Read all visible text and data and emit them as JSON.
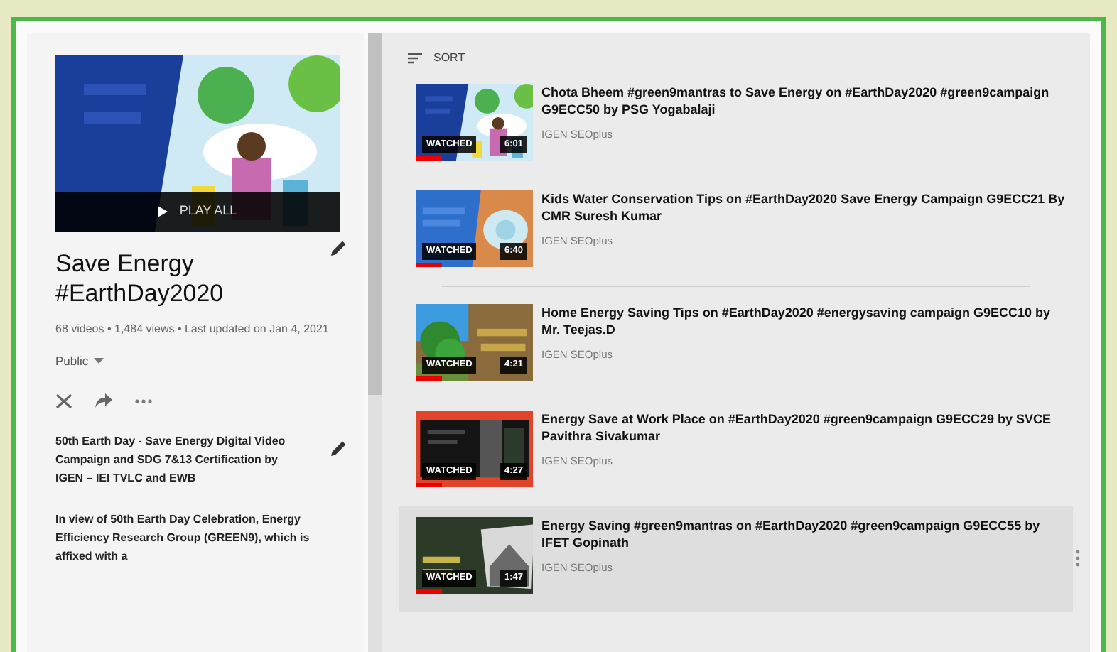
{
  "playlist": {
    "play_all": "PLAY ALL",
    "title": "Save Energy #EarthDay2020",
    "stats": "68 videos • 1,484 views • Last updated on Jan 4, 2021",
    "privacy": "Public",
    "description": "50th Earth Day - Save Energy Digital Video Campaign and SDG 7&13 Certification by IGEN – IEI TVLC and EWB",
    "about": "In view of 50th Earth Day Celebration, Energy Efficiency Research Group (GREEN9), which is affixed with a"
  },
  "sort_label": "SORT",
  "videos": [
    {
      "title": "Chota Bheem #green9mantras to Save Energy on #EarthDay2020 #green9campaign G9ECC50 by PSG Yogabalaji",
      "channel": "IGEN SEOplus",
      "status": "WATCHED",
      "duration": "6:01",
      "watched": true,
      "hovered": false
    },
    {
      "title": "Kids Water Conservation Tips on #EarthDay2020 Save Energy Campaign G9ECC21 By CMR Suresh Kumar",
      "channel": "IGEN SEOplus",
      "status": "WATCHED",
      "duration": "6:40",
      "watched": true,
      "hovered": false
    },
    {
      "title": "Home Energy Saving Tips on #EarthDay2020 #energysaving campaign G9ECC10 by Mr. Teejas.D",
      "channel": "IGEN SEOplus",
      "status": "WATCHED",
      "duration": "4:21",
      "watched": true,
      "hovered": false
    },
    {
      "title": "Energy Save at Work Place on #EarthDay2020 #green9campaign G9ECC29 by SVCE Pavithra Sivakumar",
      "channel": "IGEN SEOplus",
      "status": "WATCHED",
      "duration": "4:27",
      "watched": true,
      "hovered": false
    },
    {
      "title": "Energy Saving #green9mantras on #EarthDay2020 #green9campaign G9ECC55 by IFET Gopinath",
      "channel": "IGEN SEOplus",
      "status": "WATCHED",
      "duration": "1:47",
      "watched": true,
      "hovered": true
    }
  ]
}
